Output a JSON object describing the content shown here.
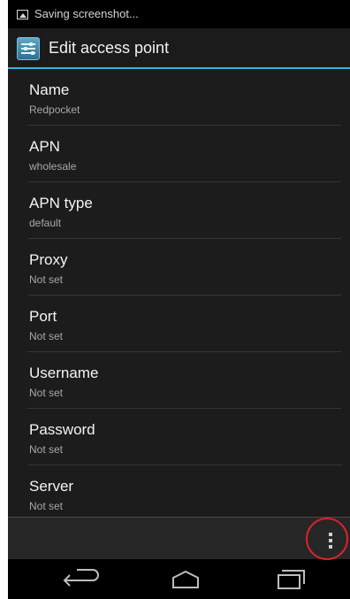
{
  "status_bar": {
    "notification_icon": "screenshot-icon",
    "text": "Saving screenshot..."
  },
  "action_bar": {
    "icon": "settings-sliders-icon",
    "title": "Edit access point"
  },
  "preferences": [
    {
      "title": "Name",
      "summary": "Redpocket"
    },
    {
      "title": "APN",
      "summary": "wholesale"
    },
    {
      "title": "APN type",
      "summary": "default"
    },
    {
      "title": "Proxy",
      "summary": "Not set"
    },
    {
      "title": "Port",
      "summary": "Not set"
    },
    {
      "title": "Username",
      "summary": "Not set"
    },
    {
      "title": "Password",
      "summary": "Not set"
    },
    {
      "title": "Server",
      "summary": "Not set"
    }
  ],
  "menu_bar": {
    "overflow_icon": "overflow-menu-icon"
  },
  "nav_bar": {
    "back_icon": "back-icon",
    "home_icon": "home-icon",
    "recent_icon": "recent-apps-icon"
  },
  "colors": {
    "accent": "#33b5e5",
    "highlight": "#d9232a",
    "background": "#1c1c1c"
  }
}
